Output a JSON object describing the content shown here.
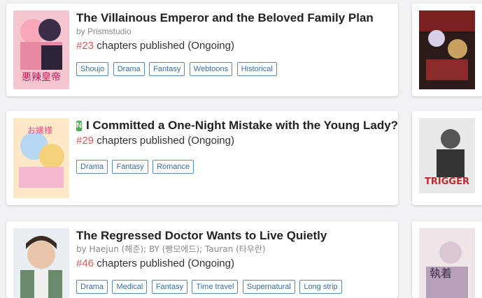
{
  "items": [
    {
      "title": "The Villainous Emperor and the Beloved Family Plan",
      "author": "by Prismstudio",
      "chapter_count": "#23",
      "chapter_text": " chapters published (Ongoing)",
      "tags": [
        "Shoujo",
        "Drama",
        "Fantasy",
        "Webtoons",
        "Historical"
      ],
      "cover_text": "悪辣皇帝"
    },
    {
      "badge": "N",
      "title": "I Committed a One-Night Mistake with the Young Lady?",
      "chapter_count": "#29",
      "chapter_text": " chapters published (Ongoing)",
      "tags": [
        "Drama",
        "Fantasy",
        "Romance"
      ],
      "cover_text": "お嬢様"
    },
    {
      "title": "The Regressed Doctor Wants to Live Quietly",
      "author": "by Haejun (해준); BY (빵모에드); Tauran (타우란)",
      "chapter_count": "#46",
      "chapter_text": " chapters published (Ongoing)",
      "tags": [
        "Drama",
        "Medical",
        "Fantasy",
        "Time travel",
        "Supernatural",
        "Long strip"
      ]
    }
  ],
  "side_items": [
    {
      "cover_text": ""
    },
    {
      "cover_text": "TRIGGER"
    },
    {
      "cover_text": "執着"
    }
  ],
  "colors": {
    "chapter_number": "#e05a5a",
    "tag": "#3a6ea5",
    "new_badge": "#4caf50"
  }
}
